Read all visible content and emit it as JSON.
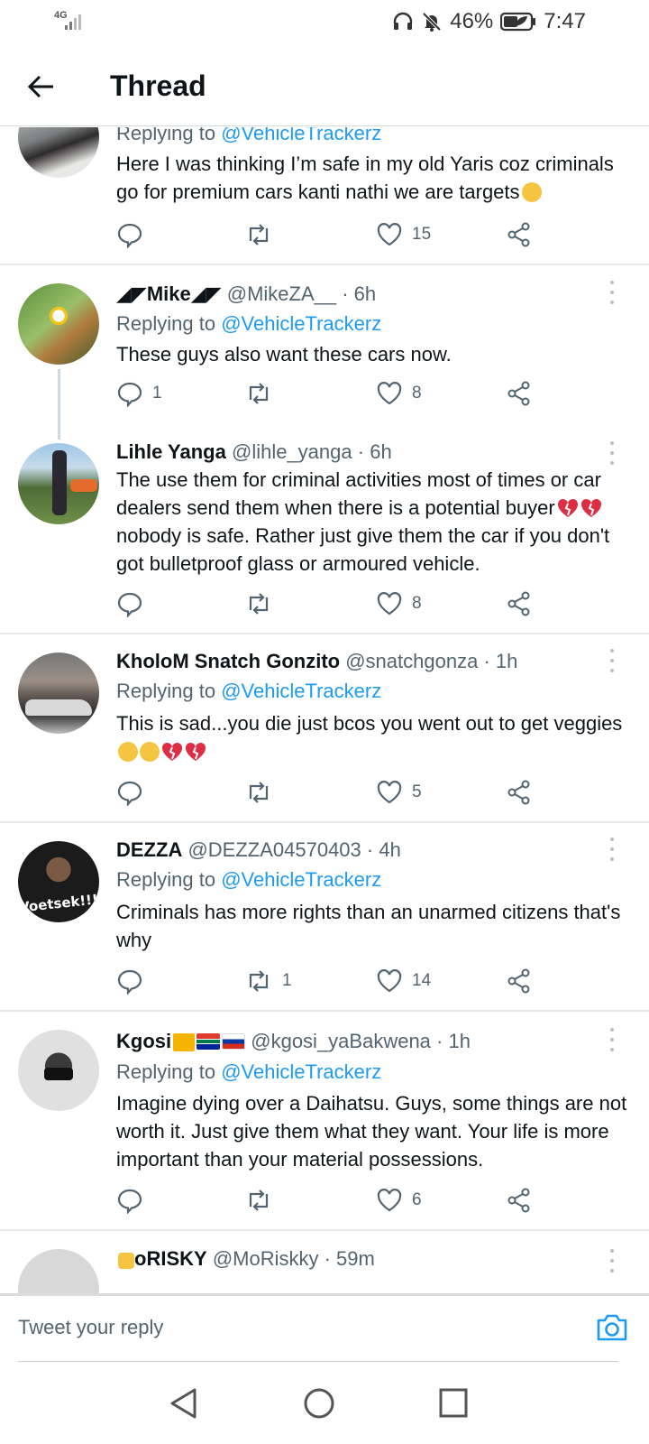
{
  "status_bar": {
    "network": "4G",
    "battery": "46%",
    "time": "7:47"
  },
  "header": {
    "title": "Thread"
  },
  "tweets": [
    {
      "name": "",
      "handle": "",
      "time": "",
      "replying_label": "Replying to",
      "replying_to": "@VehicleTrackerz",
      "text": "Here I was thinking I’m safe in my old Yaris coz criminals go for premium cars kanti nathi we are targets",
      "replies": "",
      "retweets": "",
      "likes": "15"
    },
    {
      "name": "Mike",
      "handle": "@MikeZA__",
      "time": "· 6h",
      "replying_label": "Replying to",
      "replying_to": "@VehicleTrackerz",
      "text": "These guys also want these cars now.",
      "replies": "1",
      "retweets": "",
      "likes": "8"
    },
    {
      "name": "Lihle Yanga",
      "handle": "@lihle_yanga",
      "time": "· 6h",
      "text": "The use them for criminal activities most of times or car dealers send them when there is a potential buyer",
      "text2": "nobody is safe. Rather just give them the car if you don't got bulletproof glass or armoured vehicle.",
      "replies": "",
      "retweets": "",
      "likes": "8"
    },
    {
      "name": "KholoM Snatch Gonzito",
      "handle": "@snatchgonza",
      "time": "· 1h",
      "replying_label": "Replying to",
      "replying_to": "@VehicleTrackerz",
      "text": "This is sad...you die just bcos you went out to get veggies",
      "replies": "",
      "retweets": "",
      "likes": "5"
    },
    {
      "name": "DEZZA",
      "handle": "@DEZZA04570403",
      "time": "· 4h",
      "replying_label": "Replying to",
      "replying_to": "@VehicleTrackerz",
      "text": "Criminals has more rights than an unarmed citizens that's why",
      "avatar_text": "Voetsek!!!",
      "replies": "",
      "retweets": "1",
      "likes": "14"
    },
    {
      "name": "Kgosi",
      "handle": "@kgosi_yaBakwena",
      "time": "· 1h",
      "replying_label": "Replying to",
      "replying_to": "@VehicleTrackerz",
      "text": "Imagine dying over a Daihatsu. Guys, some things are not worth it. Just give them what they want. Your life is more important than your material possessions.",
      "replies": "",
      "retweets": "",
      "likes": "6"
    },
    {
      "name": "oRISKY",
      "handle": "@MoRiskky",
      "time": "· 59m"
    }
  ],
  "reply_box": {
    "placeholder": "Tweet your reply"
  },
  "colors": {
    "link": "#1d9bf0",
    "secondary_text": "#536471",
    "divider": "#e6e9eb"
  },
  "icons": [
    "back-arrow-icon",
    "reply-icon",
    "retweet-icon",
    "like-icon",
    "share-icon",
    "more-icon",
    "camera-icon",
    "nav-back-icon",
    "nav-home-icon",
    "nav-recents-icon"
  ]
}
